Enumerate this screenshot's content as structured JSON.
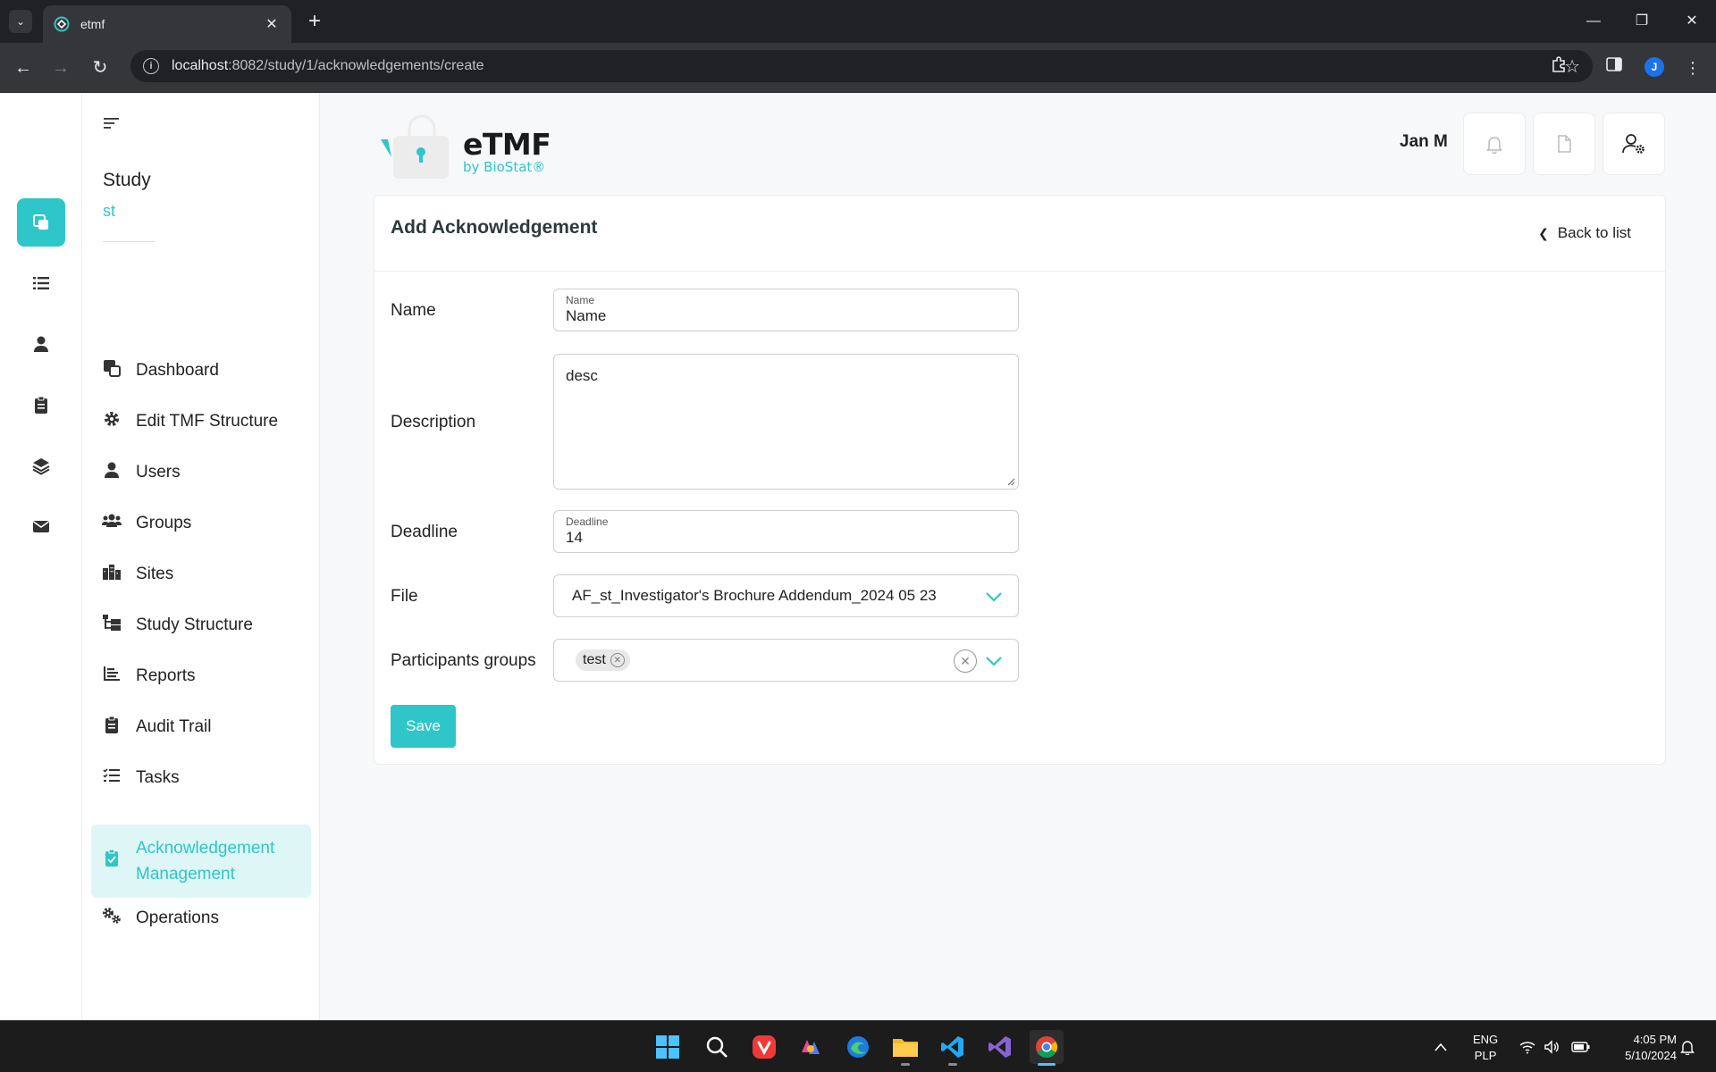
{
  "browser": {
    "tab_title": "etmf",
    "url_host": "localhost",
    "url_path": ":8082/study/1/acknowledgements/create",
    "profile_initial": "J"
  },
  "study": {
    "title": "Study",
    "subtitle": "st"
  },
  "sidebar": {
    "items": [
      {
        "label": "Dashboard",
        "icon": "dashboard-icon"
      },
      {
        "label": "Edit TMF Structure",
        "icon": "gear-icon"
      },
      {
        "label": "Users",
        "icon": "user-icon"
      },
      {
        "label": "Groups",
        "icon": "groups-icon"
      },
      {
        "label": "Sites",
        "icon": "sites-icon"
      },
      {
        "label": "Study Structure",
        "icon": "structure-icon"
      },
      {
        "label": "Reports",
        "icon": "reports-icon"
      },
      {
        "label": "Audit Trail",
        "icon": "clipboard-icon"
      },
      {
        "label": "Tasks",
        "icon": "tasks-icon"
      },
      {
        "label": "Acknowledgement Management",
        "icon": "clipboard-check-icon",
        "active": true
      },
      {
        "label": "Operations",
        "icon": "gears-icon"
      }
    ]
  },
  "header": {
    "logo_main": "eTMF",
    "logo_sub": "by BioStat®",
    "user_name": "Jan M"
  },
  "form": {
    "title": "Add Acknowledgement",
    "back_label": "Back to list",
    "name": {
      "label": "Name",
      "float_label": "Name",
      "value": "Name"
    },
    "description": {
      "label": "Description",
      "value": "desc"
    },
    "deadline": {
      "label": "Deadline",
      "float_label": "Deadline",
      "value": "14"
    },
    "file": {
      "label": "File",
      "value": "AF_st_Investigator's Brochure Addendum_2024 05 23"
    },
    "participants": {
      "label": "Participants groups",
      "chips": [
        "test"
      ]
    },
    "save_label": "Save"
  },
  "taskbar": {
    "lang_1": "ENG",
    "lang_2": "PLP",
    "time": "4:05 PM",
    "date": "5/10/2024"
  },
  "colors": {
    "accent": "#2ec6c9",
    "chrome_dark": "#202124",
    "chrome_mid": "#35363a",
    "page_bg": "#f7f8fa"
  }
}
